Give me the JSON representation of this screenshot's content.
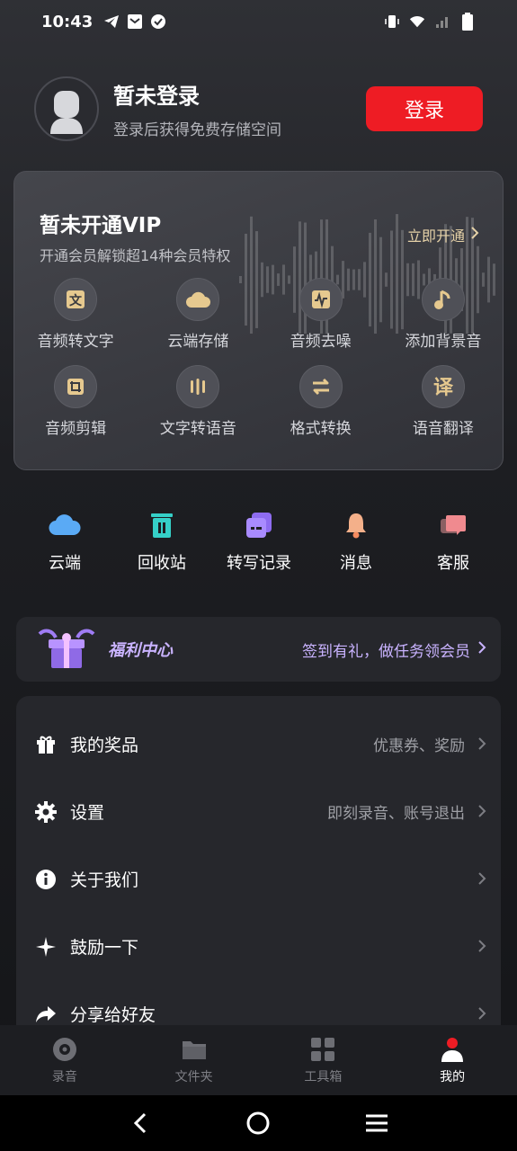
{
  "status_bar": {
    "time": "10:43"
  },
  "profile": {
    "title": "暂未登录",
    "subtitle": "登录后获得免费存储空间",
    "login_label": "登录"
  },
  "vip": {
    "title": "暂未开通VIP",
    "subtitle": "开通会员解锁超14种会员特权",
    "open_label": "立即开通",
    "features": [
      {
        "label": "音频转文字",
        "icon": "text-doc-icon"
      },
      {
        "label": "云端存储",
        "icon": "cloud-icon"
      },
      {
        "label": "音频去噪",
        "icon": "denoise-icon"
      },
      {
        "label": "添加背景音",
        "icon": "music-note-icon"
      },
      {
        "label": "音频剪辑",
        "icon": "crop-icon"
      },
      {
        "label": "文字转语音",
        "icon": "voice-bars-icon"
      },
      {
        "label": "格式转换",
        "icon": "swap-icon"
      },
      {
        "label": "语音翻译",
        "icon": "translate-icon"
      }
    ],
    "accent_color": "#e6d2a8"
  },
  "quick": [
    {
      "label": "云端",
      "icon": "cloud-blue-icon"
    },
    {
      "label": "回收站",
      "icon": "trash-icon"
    },
    {
      "label": "转写记录",
      "icon": "transcript-icon"
    },
    {
      "label": "消息",
      "icon": "bell-icon"
    },
    {
      "label": "客服",
      "icon": "chat-icon"
    }
  ],
  "welfare": {
    "title": "福利中心",
    "right_text": "签到有礼，做任务领会员"
  },
  "menu": [
    {
      "label": "我的奖品",
      "hint": "优惠券、奖励",
      "icon": "gift-icon"
    },
    {
      "label": "设置",
      "hint": "即刻录音、账号退出",
      "icon": "gear-icon"
    },
    {
      "label": "关于我们",
      "hint": "",
      "icon": "info-icon"
    },
    {
      "label": "鼓励一下",
      "hint": "",
      "icon": "sparkle-icon"
    },
    {
      "label": "分享给好友",
      "hint": "",
      "icon": "share-icon"
    }
  ],
  "tabs": [
    {
      "label": "录音",
      "icon": "record-icon"
    },
    {
      "label": "文件夹",
      "icon": "folder-icon"
    },
    {
      "label": "工具箱",
      "icon": "grid-icon"
    },
    {
      "label": "我的",
      "icon": "person-icon",
      "active": true
    }
  ],
  "colors": {
    "login_button": "#ee1c24",
    "welfare_text": "#c9b3ff"
  }
}
